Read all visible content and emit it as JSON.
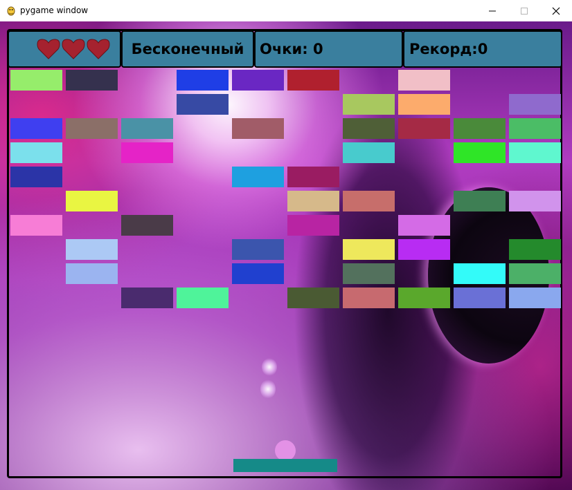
{
  "window": {
    "title": "pygame window"
  },
  "hud": {
    "lives": 3,
    "mode": "Бесконечный",
    "score_text": "Очки: 0",
    "record_text": "Рекорд:0"
  },
  "colors": {
    "hud_bg": "#3a7f9e",
    "heart": "#a5222f",
    "paddle": "#158a88",
    "ball": "#e391e6"
  },
  "bricks": [
    {
      "col": 0,
      "row": 0,
      "color": "#96ed6b"
    },
    {
      "col": 1,
      "row": 0,
      "color": "#35314e"
    },
    {
      "col": 3,
      "row": 0,
      "color": "#1f3ee6"
    },
    {
      "col": 4,
      "row": 0,
      "color": "#6a27c3"
    },
    {
      "col": 5,
      "row": 0,
      "color": "#b0202e"
    },
    {
      "col": 7,
      "row": 0,
      "color": "#f1bfc7"
    },
    {
      "col": 3,
      "row": 1,
      "color": "#374aa4"
    },
    {
      "col": 6,
      "row": 1,
      "color": "#a8c85f"
    },
    {
      "col": 7,
      "row": 1,
      "color": "#fcab6c"
    },
    {
      "col": 9,
      "row": 1,
      "color": "#8f6acd"
    },
    {
      "col": 0,
      "row": 2,
      "color": "#3f3ff0"
    },
    {
      "col": 1,
      "row": 2,
      "color": "#8b6f68"
    },
    {
      "col": 2,
      "row": 2,
      "color": "#4a92a6"
    },
    {
      "col": 4,
      "row": 2,
      "color": "#a15c68"
    },
    {
      "col": 6,
      "row": 2,
      "color": "#4f5f37"
    },
    {
      "col": 7,
      "row": 2,
      "color": "#a52a45"
    },
    {
      "col": 8,
      "row": 2,
      "color": "#4a8a3a"
    },
    {
      "col": 9,
      "row": 2,
      "color": "#4bbd66"
    },
    {
      "col": 0,
      "row": 3,
      "color": "#7be0ec"
    },
    {
      "col": 2,
      "row": 3,
      "color": "#e523c7"
    },
    {
      "col": 6,
      "row": 3,
      "color": "#48cbcd"
    },
    {
      "col": 8,
      "row": 3,
      "color": "#2fe527"
    },
    {
      "col": 9,
      "row": 3,
      "color": "#5ff7cf"
    },
    {
      "col": 0,
      "row": 4,
      "color": "#2b34a7"
    },
    {
      "col": 4,
      "row": 4,
      "color": "#1ea0e0"
    },
    {
      "col": 5,
      "row": 4,
      "color": "#9a1c62"
    },
    {
      "col": 1,
      "row": 5,
      "color": "#e9f542"
    },
    {
      "col": 5,
      "row": 5,
      "color": "#d6b98a"
    },
    {
      "col": 6,
      "row": 5,
      "color": "#c76e6b"
    },
    {
      "col": 8,
      "row": 5,
      "color": "#3e7f54"
    },
    {
      "col": 9,
      "row": 5,
      "color": "#d193ec"
    },
    {
      "col": 0,
      "row": 6,
      "color": "#f77dd6"
    },
    {
      "col": 2,
      "row": 6,
      "color": "#4a3b48"
    },
    {
      "col": 5,
      "row": 6,
      "color": "#b824a3"
    },
    {
      "col": 7,
      "row": 6,
      "color": "#d46be6"
    },
    {
      "col": 1,
      "row": 7,
      "color": "#acc9f5"
    },
    {
      "col": 4,
      "row": 7,
      "color": "#3b55ad"
    },
    {
      "col": 6,
      "row": 7,
      "color": "#eee85c"
    },
    {
      "col": 7,
      "row": 7,
      "color": "#b82cf3"
    },
    {
      "col": 9,
      "row": 7,
      "color": "#248a2c"
    },
    {
      "col": 1,
      "row": 8,
      "color": "#9bb4f0"
    },
    {
      "col": 4,
      "row": 8,
      "color": "#2040cf"
    },
    {
      "col": 6,
      "row": 8,
      "color": "#53715d"
    },
    {
      "col": 8,
      "row": 8,
      "color": "#33fbf9"
    },
    {
      "col": 9,
      "row": 8,
      "color": "#4cb068"
    },
    {
      "col": 2,
      "row": 9,
      "color": "#4a2b6e"
    },
    {
      "col": 3,
      "row": 9,
      "color": "#4ff39a"
    },
    {
      "col": 5,
      "row": 9,
      "color": "#4a5a33"
    },
    {
      "col": 6,
      "row": 9,
      "color": "#c76a6f"
    },
    {
      "col": 7,
      "row": 9,
      "color": "#5aa82c"
    },
    {
      "col": 8,
      "row": 9,
      "color": "#6a70d6"
    },
    {
      "col": 9,
      "row": 9,
      "color": "#8aa8ee"
    }
  ]
}
